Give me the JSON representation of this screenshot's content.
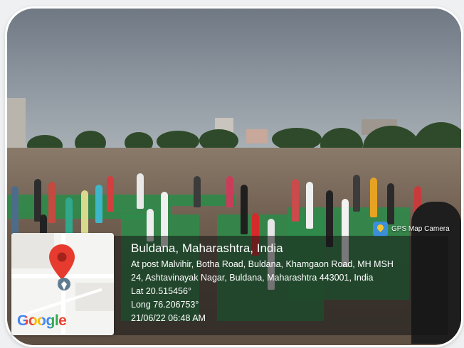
{
  "overlay": {
    "badge_label": "GPS Map Camera",
    "title": "Buldana, Maharashtra, India",
    "address_line1": "At post Malvihir, Botha Road, Buldana, Khamgaon Road, MH MSH",
    "address_line2": "24, Ashtavinayak Nagar, Buldana, Maharashtra 443001, India",
    "latitude": "Lat 20.515456°",
    "longitude": "Long 76.206753°",
    "datetime": "21/06/22 06:48 AM"
  },
  "map": {
    "logo_text": "Google",
    "pin_color": "#e63b2e"
  },
  "colors": {
    "google_blue": "#4285F4",
    "google_red": "#EA4335",
    "google_yellow": "#FBBC05",
    "google_green": "#34A853"
  },
  "icons": {
    "location_pin": "map-pin-icon",
    "app_badge": "gps-map-camera-icon"
  }
}
